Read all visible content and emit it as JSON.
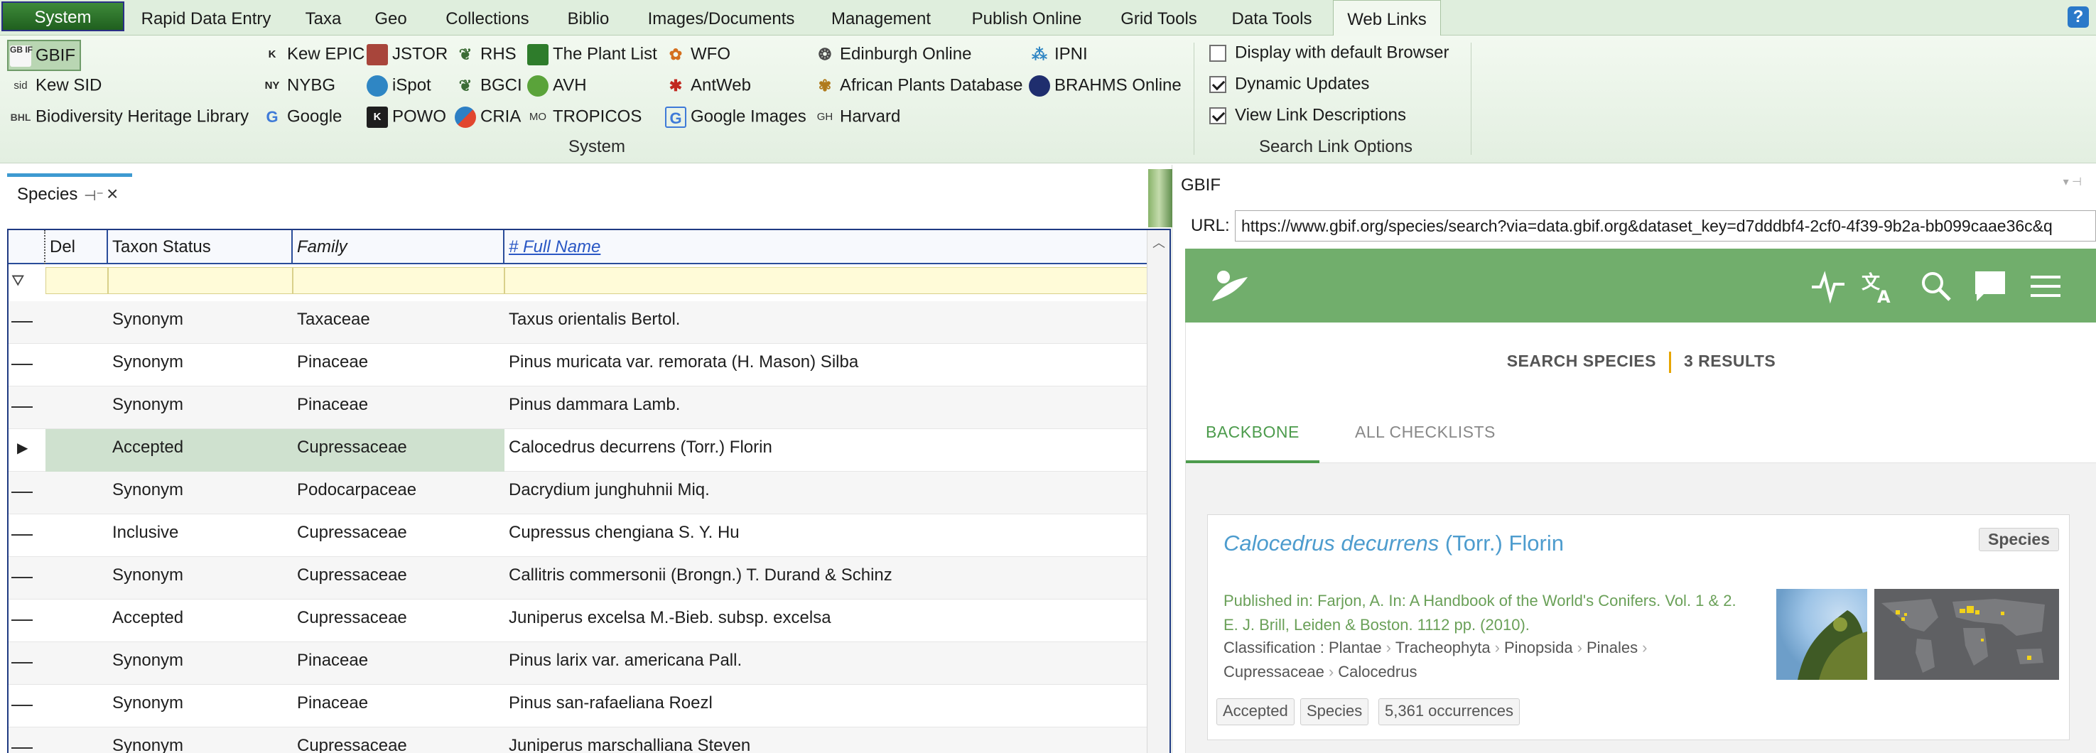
{
  "ribbon_tabs": [
    "System",
    "Rapid Data Entry",
    "Taxa",
    "Geo",
    "Collections",
    "Biblio",
    "Images/Documents",
    "Management",
    "Publish Online",
    "Grid Tools",
    "Data Tools",
    "Web Links"
  ],
  "active_tab": "Web Links",
  "help_label": "?",
  "links": {
    "gbif": "GBIF",
    "kew_sid": "Kew SID",
    "bhl": "Biodiversity Heritage Library",
    "kew_epic": "Kew EPIC",
    "nybg": "NYBG",
    "google": "Google",
    "jstor": "JSTOR",
    "ispot": "iSpot",
    "powo": "POWO",
    "rhs": "RHS",
    "bgci": "BGCI",
    "cria": "CRIA",
    "plantlist": "The Plant List",
    "avh": "AVH",
    "tropicos": "TROPICOS",
    "wfo": "WFO",
    "antweb": "AntWeb",
    "google_images": "Google Images",
    "edinburgh": "Edinburgh Online",
    "african_plants": "African Plants Database",
    "harvard": "Harvard",
    "ipni": "IPNI",
    "brahms": "BRAHMS Online"
  },
  "link_icons": {
    "gbif": "GB IF",
    "kew_sid": "sid",
    "bhl": "BHL",
    "kew_epic": "K",
    "nybg": "NY",
    "google": "G",
    "powo": "K",
    "tropicos": "MO",
    "google_images": "G",
    "harvard": "GH"
  },
  "group_system_label": "System",
  "search_options": {
    "label": "Search Link Options",
    "items": [
      {
        "label": "Display with default Browser",
        "checked": false
      },
      {
        "label": "Dynamic Updates",
        "checked": true
      },
      {
        "label": "View Link Descriptions",
        "checked": true
      }
    ]
  },
  "species": {
    "tab_label": "Species",
    "columns": [
      "Del",
      "Taxon Status",
      "Family",
      "# Full Name"
    ],
    "selected_index": 3,
    "rows": [
      {
        "status": "Synonym",
        "family": "Taxaceae",
        "name": "Taxus orientalis Bertol."
      },
      {
        "status": "Synonym",
        "family": "Pinaceae",
        "name": "Pinus muricata var. remorata (H. Mason) Silba"
      },
      {
        "status": "Synonym",
        "family": "Pinaceae",
        "name": "Pinus dammara Lamb."
      },
      {
        "status": "Accepted",
        "family": "Cupressaceae",
        "name": "Calocedrus decurrens (Torr.) Florin"
      },
      {
        "status": "Synonym",
        "family": "Podocarpaceae",
        "name": "Dacrydium junghuhnii Miq."
      },
      {
        "status": "Inclusive",
        "family": "Cupressaceae",
        "name": "Cupressus chengiana S. Y. Hu"
      },
      {
        "status": "Synonym",
        "family": "Cupressaceae",
        "name": "Callitris commersonii (Brongn.) T. Durand & Schinz"
      },
      {
        "status": "Accepted",
        "family": "Cupressaceae",
        "name": "Juniperus excelsa M.-Bieb. subsp. excelsa"
      },
      {
        "status": "Synonym",
        "family": "Pinaceae",
        "name": "Pinus larix var. americana Pall."
      },
      {
        "status": "Synonym",
        "family": "Pinaceae",
        "name": "Pinus san-rafaeliana Roezl"
      },
      {
        "status": "Synonym",
        "family": "Cupressaceae",
        "name": "Juniperus marschalliana Steven"
      }
    ]
  },
  "browser": {
    "title": "GBIF",
    "url_label": "URL:",
    "url": "https://www.gbif.org/species/search?via=data.gbif.org&dataset_key=d7dddbf4-2cf0-4f39-9b2a-bb099caae36c&q",
    "search_heading": "SEARCH SPECIES",
    "results_count": "3 RESULTS",
    "tab_backbone": "BACKBONE",
    "tab_all": "ALL CHECKLISTS",
    "result": {
      "genus_species": "Calocedrus decurrens",
      "author": "(Torr.) Florin",
      "rank_badge": "Species",
      "published_line1": "Published in: Farjon, A. In: A Handbook of the World's Conifers. Vol. 1 & 2.",
      "published_line2": "E. J. Brill, Leiden & Boston. 1112 pp. (2010).",
      "classification_label": "Classification :",
      "classification": [
        "Plantae",
        "Tracheophyta",
        "Pinopsida",
        "Pinales",
        "Cupressaceae",
        "Calocedrus"
      ],
      "pills": [
        "Accepted",
        "Species",
        "5,361 occurrences"
      ]
    }
  },
  "colors": {
    "accent_green": "#71ae6c",
    "link_blue": "#4d9cce",
    "selection": "#cfe1cf",
    "grid_border": "#1f3a82"
  }
}
